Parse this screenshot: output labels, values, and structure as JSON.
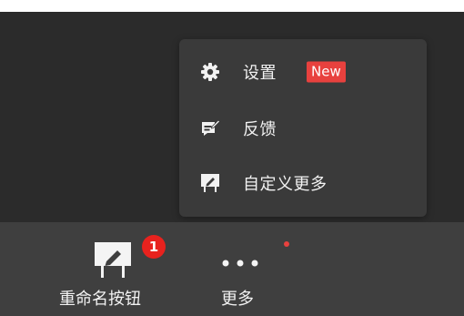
{
  "menu": {
    "items": [
      {
        "icon": "gear-icon",
        "label": "设置",
        "badge": "New"
      },
      {
        "icon": "feedback-icon",
        "label": "反馈"
      },
      {
        "icon": "easel-pencil-icon",
        "label": "自定义更多"
      }
    ]
  },
  "toolbar": {
    "rename_button": {
      "label": "重命名按钮",
      "icon": "easel-pencil-icon",
      "badge_count": "1"
    },
    "more_button": {
      "label": "更多",
      "icon": "more-dots-icon",
      "has_red_dot": true
    }
  },
  "colors": {
    "background": "#2b2b2b",
    "menu_bg": "#3a3a3a",
    "toolbar_bg": "#3f3f3f",
    "badge_red": "#e8413e",
    "text": "#f2f2f2"
  }
}
